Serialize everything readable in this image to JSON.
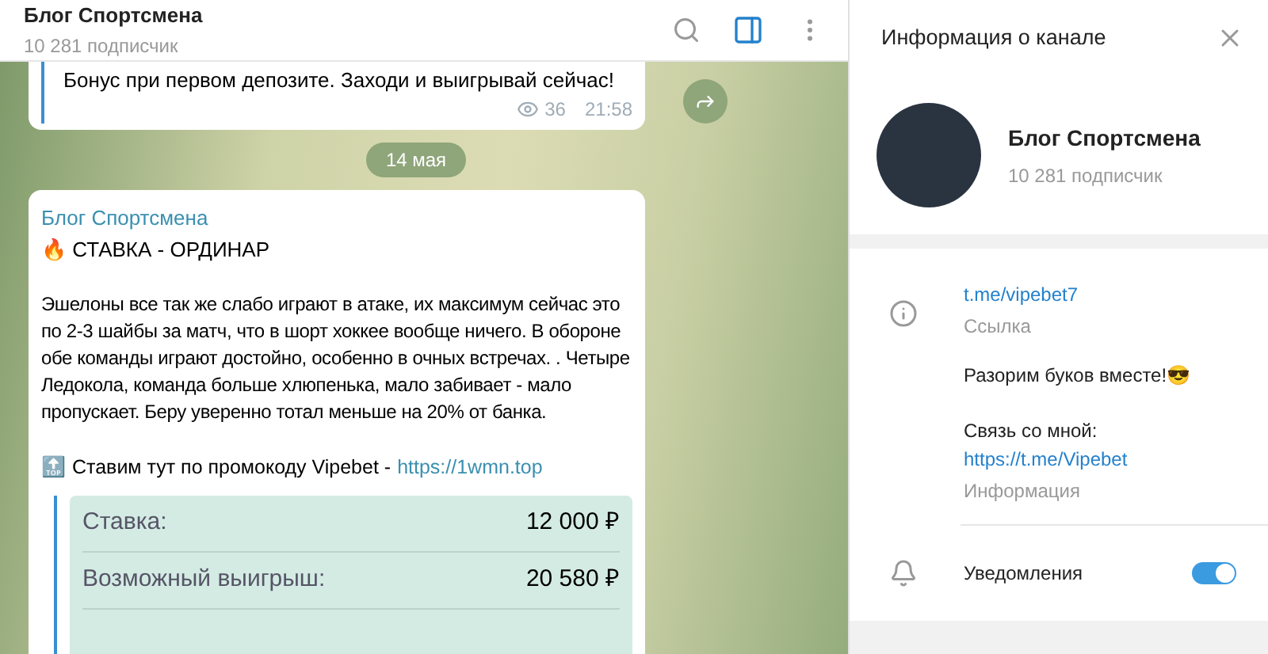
{
  "chat_header": {
    "title": "Блог Спортсмена",
    "subtitle": "10 281 подписчик"
  },
  "messages": [
    {
      "kind": "partial",
      "text": "Бонус при первом депозите. Заходи и выигрывай сейчас!",
      "views": "36",
      "time": "21:58"
    },
    {
      "kind": "date",
      "text": "14 мая"
    },
    {
      "kind": "post",
      "author": "Блог Спортсмена",
      "emoji": "🔥",
      "heading": "СТАВКА - ОРДИНАР",
      "body": "Эшелоны все так же слабо играют в атаке, их максимум сейчас это по 2-3 шайбы за матч, что в шорт хоккее вообще ничего. В обороне обе команды играют достойно, особенно в очных встречах. . Четыре Ледокола, команда больше хлюпенька, мало забивает - мало пропускает. Беру уверенно тотал меньше на 20% от банка.",
      "promo_emoji": "🔝",
      "promo": "Ставим тут по промокоду Vipebet -",
      "promo_link": "https://1wmn.top",
      "bet_rows": [
        {
          "label": "Ставка:",
          "value": "12 000 ₽"
        },
        {
          "label": "Возможный выигрыш:",
          "value": "20 580 ₽"
        }
      ]
    }
  ],
  "info_panel": {
    "title": "Информация о канале",
    "name": "Блог Спортсмена",
    "subscribers": "10 281 подписчик",
    "link": "t.me/vipebet7",
    "link_caption": "Ссылка",
    "description_line": "Разорим буков вместе!😎",
    "contact_label": "Связь со мной:",
    "contact_link": "https://t.me/Vipebet",
    "description_caption": "Информация",
    "notifications": {
      "label": "Уведомления",
      "on": true
    }
  }
}
